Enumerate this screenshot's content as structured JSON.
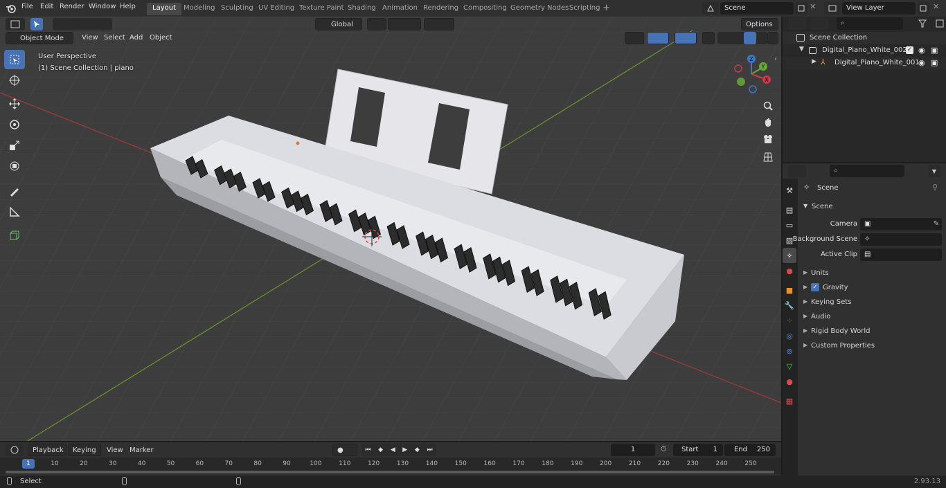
{
  "top_menu": [
    "File",
    "Edit",
    "Render",
    "Window",
    "Help"
  ],
  "workspace_tabs": [
    "Layout",
    "Modeling",
    "Sculpting",
    "UV Editing",
    "Texture Paint",
    "Shading",
    "Animation",
    "Rendering",
    "Compositing",
    "Geometry Nodes",
    "Scripting"
  ],
  "active_tab": "Layout",
  "scene_field": "Scene",
  "view_layer_field": "View Layer",
  "viewport": {
    "mode": "Object Mode",
    "menus": [
      "View",
      "Select",
      "Add",
      "Object"
    ],
    "transform_orientation": "Global",
    "options_label": "Options",
    "overlay_title": "User Perspective",
    "overlay_subtitle": "(1) Scene Collection | piano",
    "gizmo_axes": [
      "Z",
      "Y",
      "X"
    ]
  },
  "outliner": {
    "root": "Scene Collection",
    "items": [
      {
        "name": "Digital_Piano_White_002"
      },
      {
        "name": "Digital_Piano_White_001"
      }
    ]
  },
  "properties": {
    "title": "Scene",
    "section": "Scene",
    "fields": [
      {
        "label": "Camera",
        "value": ""
      },
      {
        "label": "Background Scene",
        "value": ""
      },
      {
        "label": "Active Clip",
        "value": ""
      }
    ],
    "panels": [
      "Units",
      "Gravity",
      "Keying Sets",
      "Audio",
      "Rigid Body World",
      "Custom Properties"
    ]
  },
  "timeline": {
    "menus": [
      "Playback",
      "Keying",
      "View",
      "Marker"
    ],
    "current_frame": "1",
    "start_label": "Start",
    "start_value": "1",
    "end_label": "End",
    "end_value": "250",
    "ticks": [
      "1",
      "10",
      "20",
      "30",
      "40",
      "50",
      "60",
      "70",
      "80",
      "90",
      "100",
      "110",
      "120",
      "130",
      "140",
      "150",
      "160",
      "170",
      "180",
      "190",
      "200",
      "210",
      "220",
      "230",
      "240",
      "250"
    ]
  },
  "status": {
    "left_label": "Select",
    "version": "2.93.13"
  },
  "colors": {
    "accent": "#4772b3",
    "viewport_bg": "#3d3d3d",
    "panel_bg": "#303030",
    "x_axis": "#9b3a3a",
    "y_axis": "#6a8f2e"
  }
}
